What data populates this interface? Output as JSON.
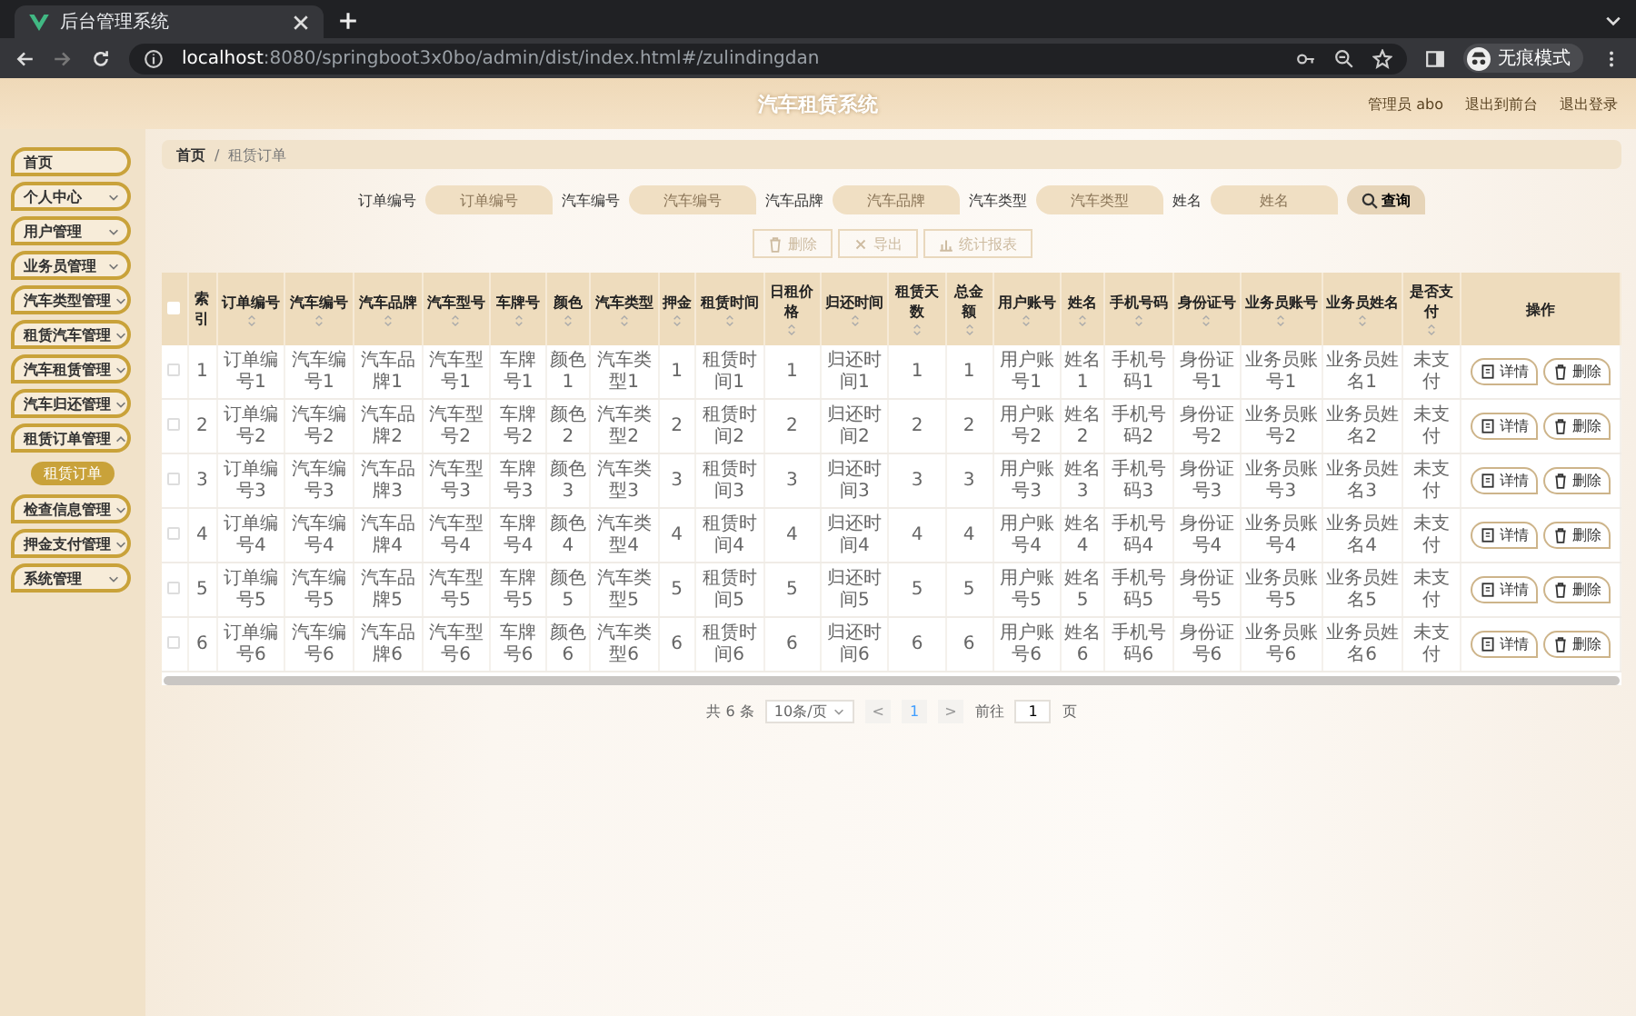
{
  "browser": {
    "tab_title": "后台管理系统",
    "url_host": "localhost",
    "url_rest": ":8080/springboot3x0bo/admin/dist/index.html#/zulindingdan",
    "profile_label": "无痕模式"
  },
  "header": {
    "title": "汽车租赁系统",
    "links": [
      "管理员 abo",
      "退出到前台",
      "退出登录"
    ]
  },
  "sidebar": {
    "items": [
      {
        "label": "首页",
        "kind": "link"
      },
      {
        "label": "个人中心",
        "kind": "menu",
        "expanded": false
      },
      {
        "label": "用户管理",
        "kind": "menu",
        "expanded": false
      },
      {
        "label": "业务员管理",
        "kind": "menu",
        "expanded": false
      },
      {
        "label": "汽车类型管理",
        "kind": "menu",
        "expanded": false
      },
      {
        "label": "租赁汽车管理",
        "kind": "menu",
        "expanded": false
      },
      {
        "label": "汽车租赁管理",
        "kind": "menu",
        "expanded": false
      },
      {
        "label": "汽车归还管理",
        "kind": "menu",
        "expanded": false
      },
      {
        "label": "租赁订单管理",
        "kind": "menu",
        "expanded": true,
        "children": [
          {
            "label": "租赁订单",
            "selected": true
          }
        ]
      },
      {
        "label": "检查信息管理",
        "kind": "menu",
        "expanded": false
      },
      {
        "label": "押金支付管理",
        "kind": "menu",
        "expanded": false
      },
      {
        "label": "系统管理",
        "kind": "menu",
        "expanded": false
      }
    ]
  },
  "breadcrumb": {
    "items": [
      "首页",
      "租赁订单"
    ],
    "separator": "/"
  },
  "search": {
    "fields": [
      {
        "label": "订单编号",
        "placeholder": "订单编号"
      },
      {
        "label": "汽车编号",
        "placeholder": "汽车编号"
      },
      {
        "label": "汽车品牌",
        "placeholder": "汽车品牌"
      },
      {
        "label": "汽车类型",
        "placeholder": "汽车类型"
      },
      {
        "label": "姓名",
        "placeholder": "姓名"
      }
    ],
    "button": "查询"
  },
  "actions": [
    {
      "label": "删除",
      "kind": "delete",
      "disabled": true
    },
    {
      "label": "导出",
      "kind": "export",
      "disabled": true
    },
    {
      "label": "统计报表",
      "kind": "chart",
      "disabled": true
    }
  ],
  "table": {
    "select_all_checked": false,
    "columns": [
      {
        "label": "索引",
        "sortable": false
      },
      {
        "label": "订单编号",
        "sortable": true
      },
      {
        "label": "汽车编号",
        "sortable": true
      },
      {
        "label": "汽车品牌",
        "sortable": true
      },
      {
        "label": "汽车型号",
        "sortable": true
      },
      {
        "label": "车牌号",
        "sortable": true
      },
      {
        "label": "颜色",
        "sortable": true
      },
      {
        "label": "汽车类型",
        "sortable": true
      },
      {
        "label": "押金",
        "sortable": true
      },
      {
        "label": "租赁时间",
        "sortable": true
      },
      {
        "label": "日租价格",
        "sortable": true
      },
      {
        "label": "归还时间",
        "sortable": true
      },
      {
        "label": "租赁天数",
        "sortable": true
      },
      {
        "label": "总金额",
        "sortable": true
      },
      {
        "label": "用户账号",
        "sortable": true
      },
      {
        "label": "姓名",
        "sortable": true
      },
      {
        "label": "手机号码",
        "sortable": true
      },
      {
        "label": "身份证号",
        "sortable": true
      },
      {
        "label": "业务员账号",
        "sortable": true
      },
      {
        "label": "业务员姓名",
        "sortable": true
      },
      {
        "label": "是否支付",
        "sortable": true
      },
      {
        "label": "操作",
        "sortable": false
      }
    ],
    "rows": [
      {
        "checked": false,
        "cells": [
          "1",
          "订单编号1",
          "汽车编号1",
          "汽车品牌1",
          "汽车型号1",
          "车牌号1",
          "颜色1",
          "汽车类型1",
          "1",
          "租赁时间1",
          "1",
          "归还时间1",
          "1",
          "1",
          "用户账号1",
          "姓名1",
          "手机号码1",
          "身份证号1",
          "业务员账号1",
          "业务员姓名1",
          "未支付"
        ],
        "buttons": [
          "详情",
          "删除"
        ]
      },
      {
        "checked": false,
        "cells": [
          "2",
          "订单编号2",
          "汽车编号2",
          "汽车品牌2",
          "汽车型号2",
          "车牌号2",
          "颜色2",
          "汽车类型2",
          "2",
          "租赁时间2",
          "2",
          "归还时间2",
          "2",
          "2",
          "用户账号2",
          "姓名2",
          "手机号码2",
          "身份证号2",
          "业务员账号2",
          "业务员姓名2",
          "未支付"
        ],
        "buttons": [
          "详情",
          "删除"
        ]
      },
      {
        "checked": false,
        "cells": [
          "3",
          "订单编号3",
          "汽车编号3",
          "汽车品牌3",
          "汽车型号3",
          "车牌号3",
          "颜色3",
          "汽车类型3",
          "3",
          "租赁时间3",
          "3",
          "归还时间3",
          "3",
          "3",
          "用户账号3",
          "姓名3",
          "手机号码3",
          "身份证号3",
          "业务员账号3",
          "业务员姓名3",
          "未支付"
        ],
        "buttons": [
          "详情",
          "删除"
        ]
      },
      {
        "checked": false,
        "cells": [
          "4",
          "订单编号4",
          "汽车编号4",
          "汽车品牌4",
          "汽车型号4",
          "车牌号4",
          "颜色4",
          "汽车类型4",
          "4",
          "租赁时间4",
          "4",
          "归还时间4",
          "4",
          "4",
          "用户账号4",
          "姓名4",
          "手机号码4",
          "身份证号4",
          "业务员账号4",
          "业务员姓名4",
          "未支付"
        ],
        "buttons": [
          "详情",
          "删除"
        ]
      },
      {
        "checked": false,
        "cells": [
          "5",
          "订单编号5",
          "汽车编号5",
          "汽车品牌5",
          "汽车型号5",
          "车牌号5",
          "颜色5",
          "汽车类型5",
          "5",
          "租赁时间5",
          "5",
          "归还时间5",
          "5",
          "5",
          "用户账号5",
          "姓名5",
          "手机号码5",
          "身份证号5",
          "业务员账号5",
          "业务员姓名5",
          "未支付"
        ],
        "buttons": [
          "详情",
          "删除"
        ]
      },
      {
        "checked": false,
        "cells": [
          "6",
          "订单编号6",
          "汽车编号6",
          "汽车品牌6",
          "汽车型号6",
          "车牌号6",
          "颜色6",
          "汽车类型6",
          "6",
          "租赁时间6",
          "6",
          "归还时间6",
          "6",
          "6",
          "用户账号6",
          "姓名6",
          "手机号码6",
          "身份证号6",
          "业务员账号6",
          "业务员姓名6",
          "未支付"
        ],
        "buttons": [
          "详情",
          "删除"
        ]
      }
    ]
  },
  "pagination": {
    "total": "共 6 条",
    "page_size": "10条/页",
    "prev": "<",
    "pages": [
      {
        "label": "1",
        "selected": true
      }
    ],
    "next": ">",
    "goto_label": "前往",
    "goto_value": "1",
    "goto_suffix": "页"
  }
}
